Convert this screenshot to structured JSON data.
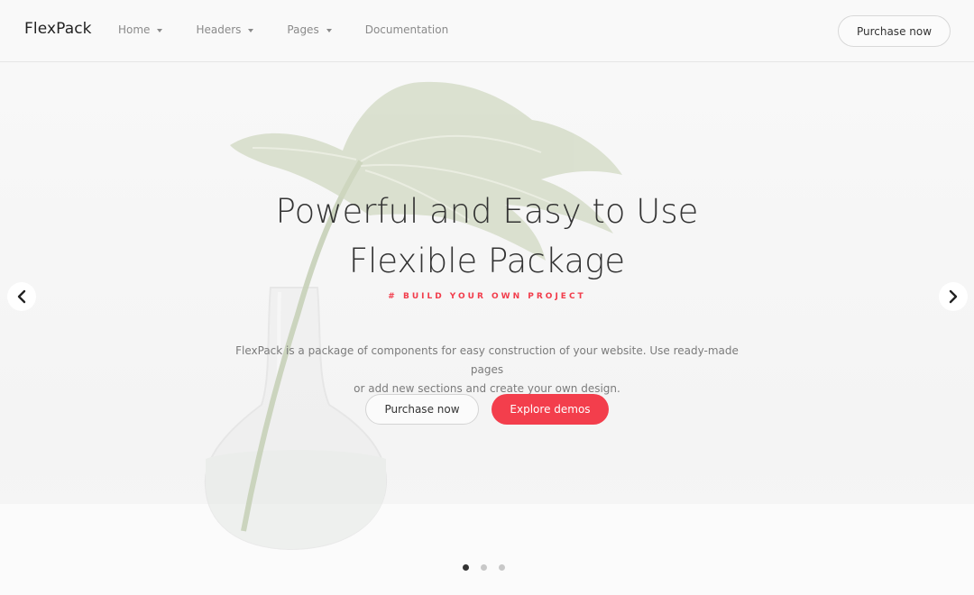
{
  "header": {
    "brand": "FlexPack",
    "nav": [
      {
        "label": "Home",
        "has_dropdown": true
      },
      {
        "label": "Headers",
        "has_dropdown": true
      },
      {
        "label": "Pages",
        "has_dropdown": true
      },
      {
        "label": "Documentation",
        "has_dropdown": false
      }
    ],
    "cta_label": "Purchase now"
  },
  "hero": {
    "title_line1": "Powerful and Easy to Use",
    "title_line2": "Flexible Package",
    "tagline": "# BUILD YOUR OWN PROJECT",
    "desc_line1": "FlexPack is a package of components for easy construction of your website. Use ready-made pages",
    "desc_line2": "or add new sections and create your own design.",
    "primary_button": "Purchase now",
    "secondary_button": "Explore demos"
  },
  "carousel": {
    "slide_count": 3,
    "active_index": 0,
    "prev_icon": "chevron-left-icon",
    "next_icon": "chevron-right-icon"
  },
  "colors": {
    "accent": "#f33e4c",
    "text_dark": "#333333",
    "text_muted": "#7b7b7b"
  }
}
